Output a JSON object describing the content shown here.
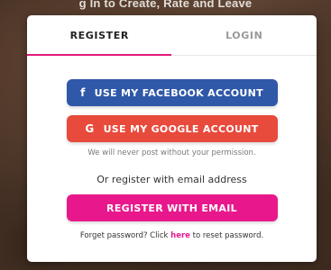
{
  "header": {
    "fragment_text": "g In to Create, Rate and Leave"
  },
  "tabs": [
    {
      "label": "REGISTER",
      "active": true
    },
    {
      "label": "LOGIN",
      "active": false
    }
  ],
  "buttons": {
    "facebook": {
      "icon": "facebook-icon",
      "glyph": "f",
      "label": "USE MY FACEBOOK ACCOUNT"
    },
    "google": {
      "icon": "google-icon",
      "glyph": "G",
      "label": "USE MY GOOGLE ACCOUNT"
    },
    "email": {
      "label": "REGISTER WITH EMAIL"
    }
  },
  "note": "We will never post without your permission.",
  "or_text": "Or register with email address",
  "footer": {
    "prefix": "Forget password? Click ",
    "link": "here",
    "suffix": " to reset password."
  },
  "colors": {
    "accent": "#e3187a",
    "facebook": "#2f58a8",
    "google": "#e84a3c",
    "email": "#e8188c"
  }
}
